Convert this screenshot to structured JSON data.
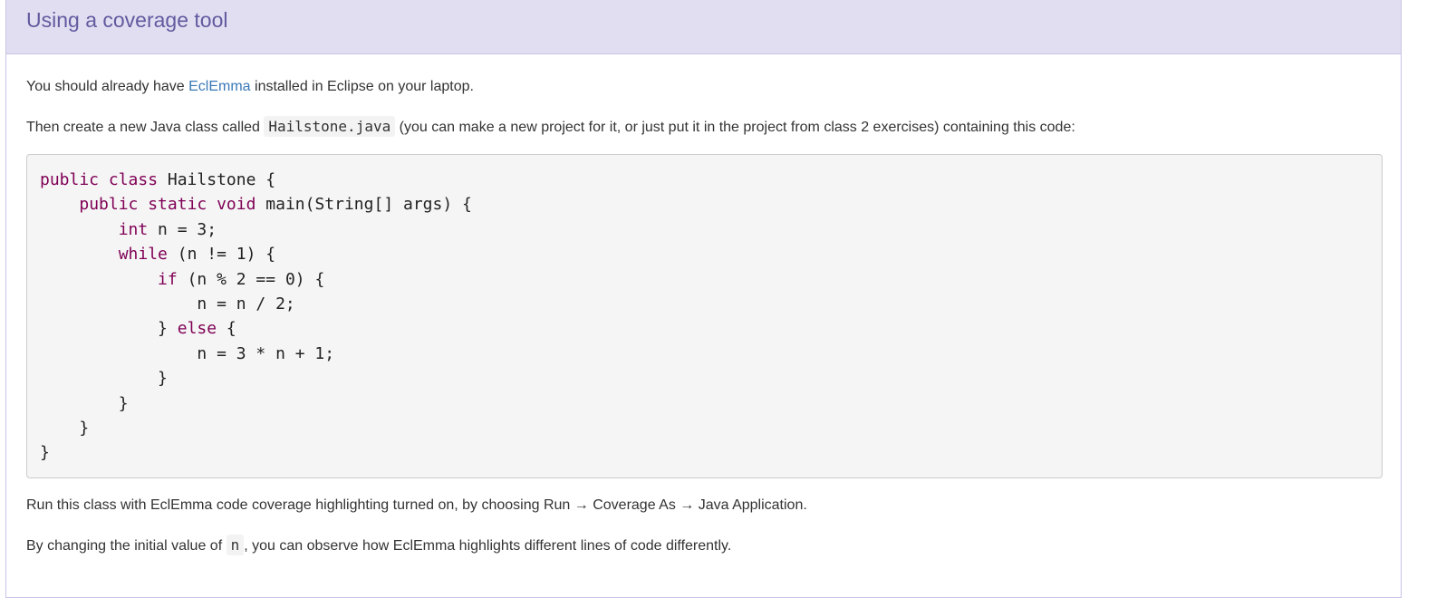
{
  "section": {
    "title": "Using a coverage tool"
  },
  "intro": {
    "before_link": "You should already have ",
    "link_text": "EclEmma",
    "after_link": " installed in Eclipse on your laptop."
  },
  "instruction": {
    "before_code": "Then create a new Java class called ",
    "code": "Hailstone.java",
    "after_code": " (you can make a new project for it, or just put it in the project from class 2 exercises) containing this code:"
  },
  "code_lines": [
    {
      "indent": "",
      "kw": "public class",
      "rest": " Hailstone {"
    },
    {
      "indent": "    ",
      "kw": "public static void",
      "rest": " main(String[] args) {"
    },
    {
      "indent": "        ",
      "kw": "int",
      "rest": " n = 3;"
    },
    {
      "indent": "        ",
      "kw": "while",
      "rest": " (n != 1) {"
    },
    {
      "indent": "            ",
      "kw": "if",
      "rest": " (n % 2 == 0) {"
    },
    {
      "indent": "                ",
      "kw": "",
      "rest": "n = n / 2;"
    },
    {
      "indent": "            ",
      "kw": "",
      "rest": "} ",
      "kw2": "else",
      "rest2": " {"
    },
    {
      "indent": "                ",
      "kw": "",
      "rest": "n = 3 * n + 1;"
    },
    {
      "indent": "            ",
      "kw": "",
      "rest": "}"
    },
    {
      "indent": "        ",
      "kw": "",
      "rest": "}"
    },
    {
      "indent": "    ",
      "kw": "",
      "rest": "}"
    },
    {
      "indent": "",
      "kw": "",
      "rest": "}"
    }
  ],
  "run_instruction": "Run this class with EclEmma code coverage highlighting turned on, by choosing Run → Coverage As → Java Application.",
  "observe": {
    "before_code": "By changing the initial value of ",
    "code": "n",
    "after_code": ", you can observe how EclEmma highlights different lines of code differently."
  },
  "colors": {
    "heading_bg": "#e1def2",
    "heading_text": "#625a9e",
    "link": "#3a79b8",
    "keyword": "#7f0055"
  }
}
